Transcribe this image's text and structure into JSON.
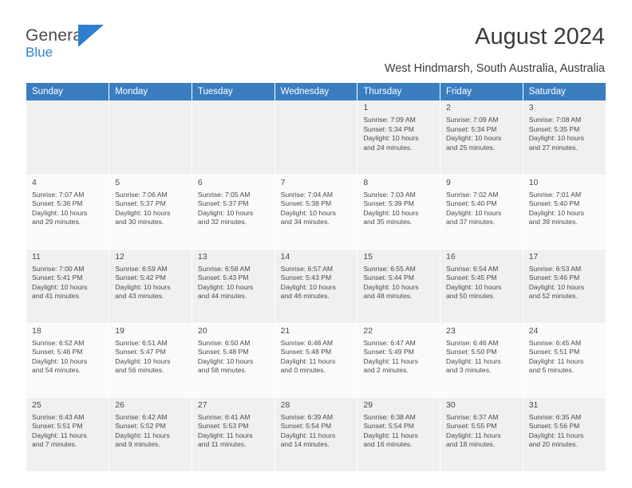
{
  "brand": {
    "name_top": "General",
    "name_bottom": "Blue",
    "flag_icon": "blue-flag-icon",
    "accent_color": "#2f7fd1"
  },
  "header": {
    "title": "August 2024",
    "location": "West Hindmarsh, South Australia, Australia"
  },
  "calendar": {
    "header_bg": "#3a7dc1",
    "weekdays": [
      "Sunday",
      "Monday",
      "Tuesday",
      "Wednesday",
      "Thursday",
      "Friday",
      "Saturday"
    ],
    "weeks": [
      [
        {
          "day": "",
          "lines": []
        },
        {
          "day": "",
          "lines": []
        },
        {
          "day": "",
          "lines": []
        },
        {
          "day": "",
          "lines": []
        },
        {
          "day": "1",
          "lines": [
            "Sunrise: 7:09 AM",
            "Sunset: 5:34 PM",
            "Daylight: 10 hours",
            "and 24 minutes."
          ]
        },
        {
          "day": "2",
          "lines": [
            "Sunrise: 7:09 AM",
            "Sunset: 5:34 PM",
            "Daylight: 10 hours",
            "and 25 minutes."
          ]
        },
        {
          "day": "3",
          "lines": [
            "Sunrise: 7:08 AM",
            "Sunset: 5:35 PM",
            "Daylight: 10 hours",
            "and 27 minutes."
          ]
        }
      ],
      [
        {
          "day": "4",
          "lines": [
            "Sunrise: 7:07 AM",
            "Sunset: 5:36 PM",
            "Daylight: 10 hours",
            "and 29 minutes."
          ]
        },
        {
          "day": "5",
          "lines": [
            "Sunrise: 7:06 AM",
            "Sunset: 5:37 PM",
            "Daylight: 10 hours",
            "and 30 minutes."
          ]
        },
        {
          "day": "6",
          "lines": [
            "Sunrise: 7:05 AM",
            "Sunset: 5:37 PM",
            "Daylight: 10 hours",
            "and 32 minutes."
          ]
        },
        {
          "day": "7",
          "lines": [
            "Sunrise: 7:04 AM",
            "Sunset: 5:38 PM",
            "Daylight: 10 hours",
            "and 34 minutes."
          ]
        },
        {
          "day": "8",
          "lines": [
            "Sunrise: 7:03 AM",
            "Sunset: 5:39 PM",
            "Daylight: 10 hours",
            "and 35 minutes."
          ]
        },
        {
          "day": "9",
          "lines": [
            "Sunrise: 7:02 AM",
            "Sunset: 5:40 PM",
            "Daylight: 10 hours",
            "and 37 minutes."
          ]
        },
        {
          "day": "10",
          "lines": [
            "Sunrise: 7:01 AM",
            "Sunset: 5:40 PM",
            "Daylight: 10 hours",
            "and 39 minutes."
          ]
        }
      ],
      [
        {
          "day": "11",
          "lines": [
            "Sunrise: 7:00 AM",
            "Sunset: 5:41 PM",
            "Daylight: 10 hours",
            "and 41 minutes."
          ]
        },
        {
          "day": "12",
          "lines": [
            "Sunrise: 6:59 AM",
            "Sunset: 5:42 PM",
            "Daylight: 10 hours",
            "and 43 minutes."
          ]
        },
        {
          "day": "13",
          "lines": [
            "Sunrise: 6:58 AM",
            "Sunset: 5:43 PM",
            "Daylight: 10 hours",
            "and 44 minutes."
          ]
        },
        {
          "day": "14",
          "lines": [
            "Sunrise: 6:57 AM",
            "Sunset: 5:43 PM",
            "Daylight: 10 hours",
            "and 46 minutes."
          ]
        },
        {
          "day": "15",
          "lines": [
            "Sunrise: 6:55 AM",
            "Sunset: 5:44 PM",
            "Daylight: 10 hours",
            "and 48 minutes."
          ]
        },
        {
          "day": "16",
          "lines": [
            "Sunrise: 6:54 AM",
            "Sunset: 5:45 PM",
            "Daylight: 10 hours",
            "and 50 minutes."
          ]
        },
        {
          "day": "17",
          "lines": [
            "Sunrise: 6:53 AM",
            "Sunset: 5:46 PM",
            "Daylight: 10 hours",
            "and 52 minutes."
          ]
        }
      ],
      [
        {
          "day": "18",
          "lines": [
            "Sunrise: 6:52 AM",
            "Sunset: 5:46 PM",
            "Daylight: 10 hours",
            "and 54 minutes."
          ]
        },
        {
          "day": "19",
          "lines": [
            "Sunrise: 6:51 AM",
            "Sunset: 5:47 PM",
            "Daylight: 10 hours",
            "and 56 minutes."
          ]
        },
        {
          "day": "20",
          "lines": [
            "Sunrise: 6:50 AM",
            "Sunset: 5:48 PM",
            "Daylight: 10 hours",
            "and 58 minutes."
          ]
        },
        {
          "day": "21",
          "lines": [
            "Sunrise: 6:48 AM",
            "Sunset: 5:48 PM",
            "Daylight: 11 hours",
            "and 0 minutes."
          ]
        },
        {
          "day": "22",
          "lines": [
            "Sunrise: 6:47 AM",
            "Sunset: 5:49 PM",
            "Daylight: 11 hours",
            "and 2 minutes."
          ]
        },
        {
          "day": "23",
          "lines": [
            "Sunrise: 6:46 AM",
            "Sunset: 5:50 PM",
            "Daylight: 11 hours",
            "and 3 minutes."
          ]
        },
        {
          "day": "24",
          "lines": [
            "Sunrise: 6:45 AM",
            "Sunset: 5:51 PM",
            "Daylight: 11 hours",
            "and 5 minutes."
          ]
        }
      ],
      [
        {
          "day": "25",
          "lines": [
            "Sunrise: 6:43 AM",
            "Sunset: 5:51 PM",
            "Daylight: 11 hours",
            "and 7 minutes."
          ]
        },
        {
          "day": "26",
          "lines": [
            "Sunrise: 6:42 AM",
            "Sunset: 5:52 PM",
            "Daylight: 11 hours",
            "and 9 minutes."
          ]
        },
        {
          "day": "27",
          "lines": [
            "Sunrise: 6:41 AM",
            "Sunset: 5:53 PM",
            "Daylight: 11 hours",
            "and 11 minutes."
          ]
        },
        {
          "day": "28",
          "lines": [
            "Sunrise: 6:39 AM",
            "Sunset: 5:54 PM",
            "Daylight: 11 hours",
            "and 14 minutes."
          ]
        },
        {
          "day": "29",
          "lines": [
            "Sunrise: 6:38 AM",
            "Sunset: 5:54 PM",
            "Daylight: 11 hours",
            "and 16 minutes."
          ]
        },
        {
          "day": "30",
          "lines": [
            "Sunrise: 6:37 AM",
            "Sunset: 5:55 PM",
            "Daylight: 11 hours",
            "and 18 minutes."
          ]
        },
        {
          "day": "31",
          "lines": [
            "Sunrise: 6:35 AM",
            "Sunset: 5:56 PM",
            "Daylight: 11 hours",
            "and 20 minutes."
          ]
        }
      ]
    ]
  }
}
